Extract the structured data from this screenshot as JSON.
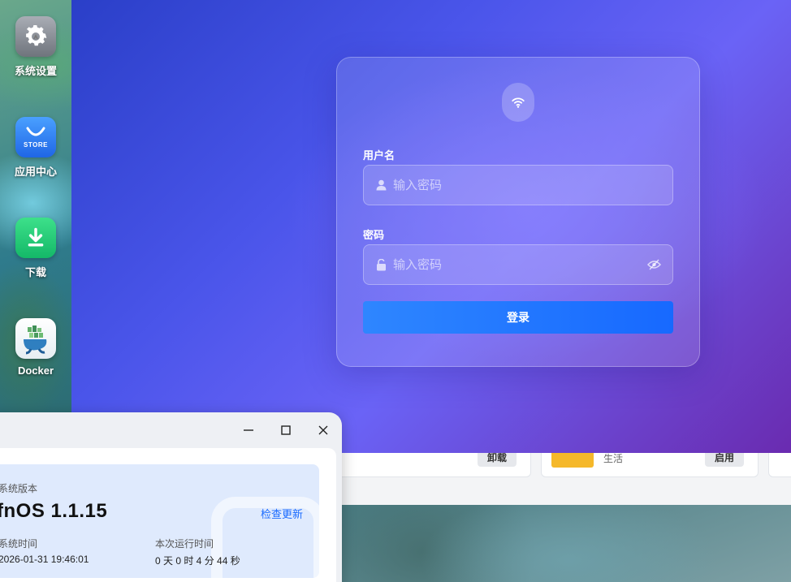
{
  "desktop": {
    "icons": [
      {
        "label": "系统设置",
        "icon": "gear-icon"
      },
      {
        "label": "应用中心",
        "icon": "store-bag-icon",
        "tile_text": "STORE"
      },
      {
        "label": "下载",
        "icon": "download-icon"
      },
      {
        "label": "Docker",
        "icon": "docker-whale-icon"
      }
    ]
  },
  "background_app": {
    "cards": [
      {
        "chip": "卸载"
      },
      {
        "category": "生活",
        "chip": "启用"
      }
    ]
  },
  "login": {
    "username_label": "用户名",
    "username_placeholder": "输入密码",
    "password_label": "密码",
    "password_placeholder": "输入密码",
    "login_button": "登录"
  },
  "system_window": {
    "version_label": "系统版本",
    "version_value": "fnOS  1.1.15",
    "check_update": "检查更新",
    "system_time_label": "系统时间",
    "system_time_value": "2026-01-31 19:46:01",
    "uptime_label": "本次运行时间",
    "uptime_value": "0 天 0 时 4 分 44 秒"
  },
  "colors": {
    "accent": "#1769ff",
    "login_gradient_start": "#2a3fc8",
    "login_gradient_end": "#6a2bb0"
  }
}
